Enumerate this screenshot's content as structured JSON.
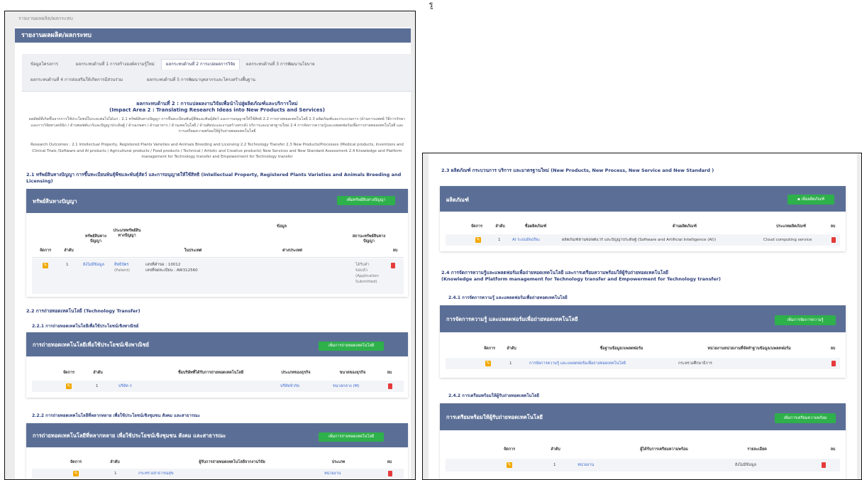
{
  "caption": "รู",
  "left": {
    "breadcrumb": "รายงานผลผลิต/ผลกระทบ",
    "header": "รายงานผลผลิต/ผลกระทบ",
    "tabs": [
      "ข้อมูลโครงการ",
      "ผลกระทบด้านที่ 1 การสร้างองค์ความรู้ใหม่",
      "ผลกระทบด้านที่ 2 การแปลผลการวิจัย",
      "ผลกระทบด้านที่ 3 การพัฒนานโยบาย",
      "ผลกระทบด้านที่ 4 การส่งเสริมให้เกิดการมีส่วนร่วม",
      "ผลกระทบด้านที่ 5 การพัฒนาบุคลากรและโครงสร้างพื้นฐาน"
    ],
    "intro_title_th": "ผลกระทบด้านที่ 2 : การแปลผลงานวิจัยเพื่อนำไปสู่ผลิตภัณฑ์และบริการใหม่",
    "intro_title_en": "(Impact Area 2 : Translating Research Ideas into New Products and Services)",
    "intro_th": "ผลลัพธ์ที่เกิดขึ้นจากการใช้ประโยชน์ในระยะต่อไปได้แก่ : 2.1 ทรัพย์สินทางปัญญา การขึ้นทะเบียนพันธุ์พืชและพันธุ์สัตว์ และการอนุญาตให้ใช้สิทธิ 2.2 การถ่ายทอดเทคโนโลยี 2.3 ผลิตภัณฑ์และกระบวนการ (ด้านการแพทย์ วิธีการรักษา และการวิจัยทางคลินิก / ด้านซอฟต์แวร์และปัญญาประดิษฐ์ / ด้านเกษตร / ด้านอาหาร / ด้านเทคโนโลยี / ด้านศิลปะและงานสร้างสรรค์) บริการและมาตรฐานใหม่ 2.4 การจัดการความรู้และแพลตฟอร์มเพื่อการถ่ายทอดเทคโนโลยี และการเตรียมความพร้อมให้ผู้รับถ่ายทอดเทคโนโลยี",
    "intro_en": "Research Outcomes : 2.1 Intellectual Property, Registered Plants Varieties and Animals Breeding and Licensing 2.2 Technology Transfer 2.3 New Products/Processes (Medical products, Inventions and Clinical Trials /Software and AI products / Agricultural products / Food products / Technical / Artistic and Creative products) New Services and New Standard Assessment 2.4 Knowledge and Platform management for Technology transfer and Empowerment for Technology transfer",
    "sec21_title": "2.1 ทรัพย์สินทางปัญญา การขึ้นทะเบียนพันธุ์พืชและพันธุ์สัตว์ และการอนุญาตให้ใช้สิทธิ (Intellectual Property, Registered Plants Varieties and Animals Breeding and Licensing)",
    "ip_card": {
      "title": "ทรัพย์สินทางปัญญา",
      "button": "เพิ่มทรัพย์สินทางปัญญา",
      "group_header": "ข้อมูล",
      "headers": [
        "จัดการ",
        "ลำดับ",
        "ทรัพย์สินทางปัญญา",
        "ประเภททรัพย์สินทางปัญญา",
        "ในประเทศ",
        "ต่างประเทศ",
        "สถานะทรัพย์สินทางปัญญา",
        "ลบ"
      ],
      "row": {
        "no": "1",
        "ip": "ยังไม่มีข้อมูล",
        "type_th": "สิทธิบัตร",
        "type_en": "(Patent)",
        "domestic_line1": "เลขที่คำขอ : 10012",
        "domestic_line2": "เลขที่จดทะเบียน : AW312560",
        "status_line1": "ได้รับคำ",
        "status_line2": "ขอแล้ว",
        "status_line3": "(Application",
        "status_line4": "Submitted)"
      }
    },
    "sec22_title": "2.2 การถ่ายทอดเทคโนโลยี (Technology Transfer)",
    "sec221_title": "2.2.1 การถ่ายทอดเทคโนโลยีเพื่อใช้ประโยชน์เชิงพาณิชย์",
    "tt_card": {
      "title": "การถ่ายทอดเทคโนโลยีเพื่อใช้ประโยชน์เชิงพาณิชย์",
      "button": "เพิ่มการถ่ายทอดเทคโนโลยี",
      "headers": [
        "จัดการ",
        "ลำดับ",
        "ชื่อบริษัทที่ได้รับการถ่ายทอดเทคโนโลยี",
        "ประเภทของธุรกิจ",
        "ขนาดของธุรกิจ",
        "ลบ"
      ],
      "row": {
        "no": "1",
        "company": "บริษัท ก",
        "type": "บริษัทจำกัด",
        "size": "ขนาดกลาง (M)"
      }
    },
    "sec222_title": "2.2.2 การถ่ายทอดเทคโนโลยีที่หลากหลาย เพื่อใช้ประโยชน์เชิงชุมชน สังคม และสาธารณะ",
    "ps_card": {
      "title": "การถ่ายทอดเทคโนโลยีที่หลากหลาย เพื่อใช้ประโยชน์เชิงชุมชน สังคม และสาธารณะ",
      "button": "เพิ่มการถ่ายทอดเทคโนโลยี",
      "headers": [
        "จัดการ",
        "ลำดับ",
        "ผู้รับการถ่ายทอดเทคโนโลยีจากงานวิจัย",
        "ประเภท",
        "ลบ"
      ],
      "row": {
        "no": "1",
        "receiver": "กระทรวงสาธารณสุข",
        "type": "หน่วยงาน"
      }
    }
  },
  "right": {
    "sec23_title": "2.3 ผลิตภัณฑ์ กระบวนการ บริการ และมาตรฐานใหม่ (New Products, New Process, New Service and New Standard )",
    "product_card": {
      "title": "ผลิตภัณฑ์",
      "button": "เพิ่มผลิตภัณฑ์",
      "headers": [
        "จัดการ",
        "ลำดับ",
        "ชื่อผลิตภัณฑ์",
        "ด้านผลิตภัณฑ์",
        "ประเภทผลิตภัณฑ์",
        "ลบ"
      ],
      "row": {
        "no": "1",
        "name": "AI ระบบอัจฉริยะ",
        "field": "ผลิตภัณฑ์ด้านซอฟต์แวร์ และปัญญาประดิษฐ์ (Software and Artificial Intelligence (AI))",
        "type": "Cloud computing service"
      }
    },
    "sec24_title_th": "2.4 การจัดการความรู้และแพลตฟอร์มเพื่อถ่ายทอดเทคโนโลยี และการเตรียมความพร้อมให้ผู้รับถ่ายทอดเทคโนโลยี",
    "sec24_title_en": "(Knowledge and Platform management for Technology transfer and Empowerment for Technology transfer)",
    "sec241_title": "2.4.1 การจัดการความรู้ และแพลตฟอร์มเพื่อถ่ายทอดเทคโนโลยี",
    "km_card": {
      "title": "การจัดการความรู้ และแพลตฟอร์มเพื่อถ่ายทอดเทคโนโลยี",
      "button": "เพิ่มการจัดการความรู้",
      "headers": [
        "จัดการ",
        "ลำดับ",
        "ชื่อฐานข้อมูล/แพลตฟอร์ม",
        "หน่วยงานหน่วยงานที่จัดทำฐานข้อมูล/แพลตฟอร์ม",
        "ลบ"
      ],
      "row": {
        "no": "1",
        "name": "การจัดการความรู้ และแพลตฟอร์มเพื่อถ่ายทอดเทคโนโลยี",
        "org": "กระทรวงศึกษาธิการ"
      }
    },
    "sec242_title": "2.4.2 การเตรียมพร้อมให้ผู้รับถ่ายทอดเทคโนโลยี",
    "prep_card": {
      "title": "การเตรียมพร้อมให้ผู้รับถ่ายทอดเทคโนโลยี",
      "button": "เพิ่มการเตรียมความพร้อม",
      "headers": [
        "จัดการ",
        "ลำดับ",
        "ผู้ได้รับการเตรียมความพร้อม",
        "รายละเอียด",
        "ลบ"
      ],
      "row": {
        "no": "1",
        "receiver": "หน่วยงาน",
        "detail": "ยังไม่มีข้อมูล"
      }
    }
  }
}
